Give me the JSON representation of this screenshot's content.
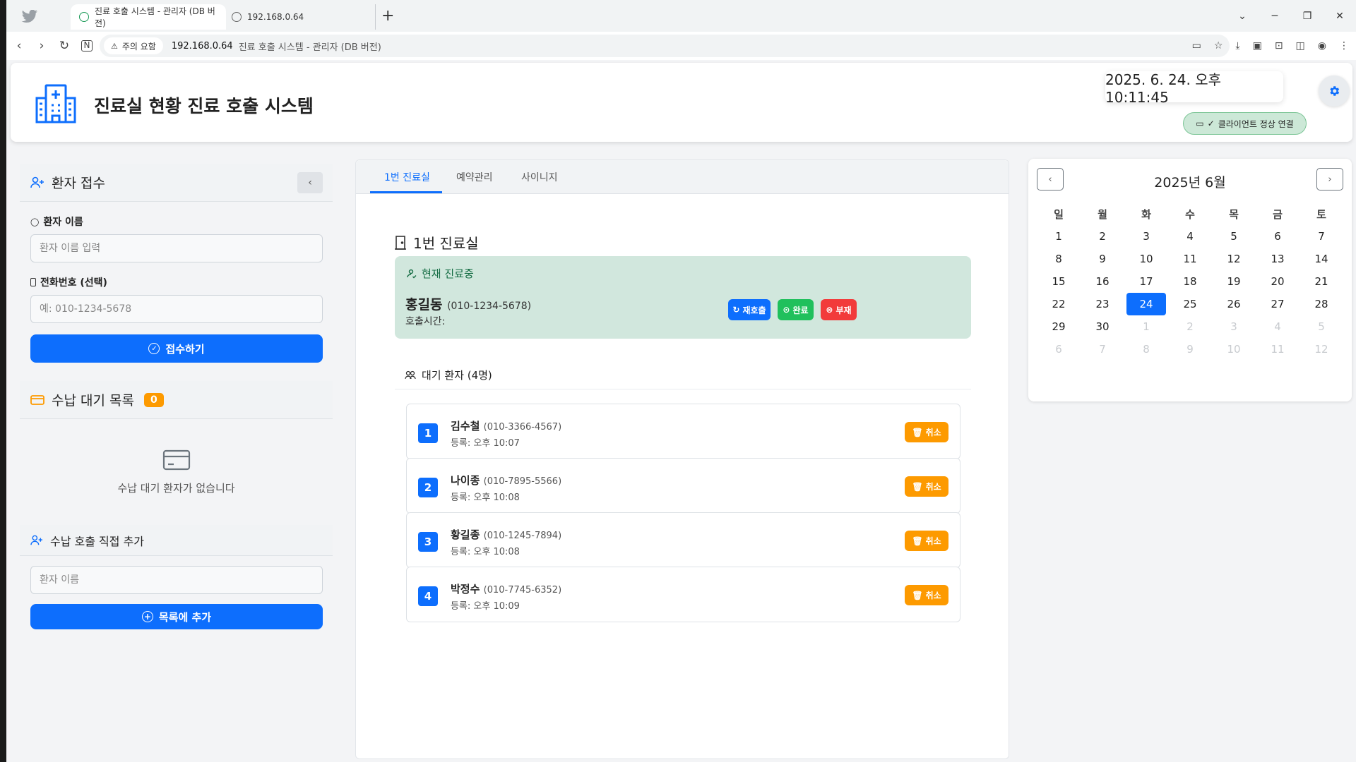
{
  "browser": {
    "tabs": [
      {
        "title": "진료 호출 시스템 - 관리자 (DB 버전)"
      },
      {
        "title": "192.168.0.64"
      }
    ],
    "security_chip": "주의 요함",
    "url_host": "192.168.0.64",
    "url_title": "진료 호출 시스템 - 관리자 (DB 버전)"
  },
  "header": {
    "title": "진료실 현황 진료 호출 시스템",
    "clock": "2025. 6. 24. 오후 10:11:45",
    "connection_status": "클라이언트 정상 연결"
  },
  "reception": {
    "title": "환자 접수",
    "name_label": "환자 이름",
    "name_placeholder": "환자 이름 입력",
    "phone_label": "전화번호 (선택)",
    "phone_placeholder": "예: 010-1234-5678",
    "submit_label": "접수하기"
  },
  "payment": {
    "title": "수납 대기 목록",
    "count": "0",
    "empty_text": "수납 대기 환자가 없습니다",
    "add_title": "수납 호출 직접 추가",
    "add_placeholder": "환자 이름",
    "add_button": "목록에 추가"
  },
  "tabs": [
    "1번 진료실",
    "예약관리",
    "사이니지"
  ],
  "room": {
    "title": "1번 진료실",
    "current_label": "현재 진료중",
    "current_name": "홍길동",
    "current_phone": "(010-1234-5678)",
    "call_time_label": "호출시간:",
    "recall_label": "재호출",
    "done_label": "완료",
    "absent_label": "부재",
    "waiting_title": "대기 환자 (4명)",
    "cancel_label": "취소",
    "queue": [
      {
        "num": "1",
        "name": "김수철",
        "phone": "(010-3366-4567)",
        "registered": "등록: 오후 10:07"
      },
      {
        "num": "2",
        "name": "나이종",
        "phone": "(010-7895-5566)",
        "registered": "등록: 오후 10:08"
      },
      {
        "num": "3",
        "name": "황길종",
        "phone": "(010-1245-7894)",
        "registered": "등록: 오후 10:08"
      },
      {
        "num": "4",
        "name": "박정수",
        "phone": "(010-7745-6352)",
        "registered": "등록: 오후 10:09"
      }
    ]
  },
  "calendar": {
    "title": "2025년 6월",
    "weekdays": [
      "일",
      "월",
      "화",
      "수",
      "목",
      "금",
      "토"
    ],
    "days": [
      "1",
      "2",
      "3",
      "4",
      "5",
      "6",
      "7",
      "8",
      "9",
      "10",
      "11",
      "12",
      "13",
      "14",
      "15",
      "16",
      "17",
      "18",
      "19",
      "20",
      "21",
      "22",
      "23",
      "24",
      "25",
      "26",
      "27",
      "28",
      "29",
      "30"
    ],
    "next_month_days": [
      "1",
      "2",
      "3",
      "4",
      "5",
      "6",
      "7",
      "8",
      "9",
      "10",
      "11",
      "12"
    ],
    "today": "24"
  },
  "colors": {
    "primary": "#0d6efd",
    "success": "#20c05c",
    "danger": "#f23b3b",
    "warning": "#fd9a00",
    "current_bg": "#d1e7dd"
  }
}
